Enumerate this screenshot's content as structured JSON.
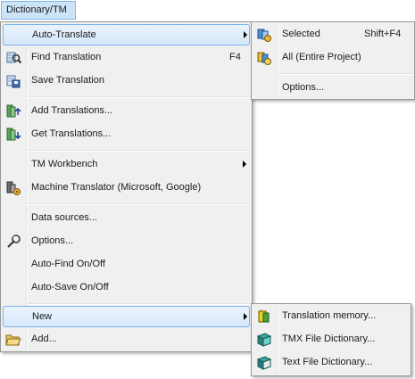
{
  "menubar": {
    "dictionary_tm": "Dictionary/TM"
  },
  "main_menu": {
    "auto_translate": "Auto-Translate",
    "find_translation": "Find Translation",
    "find_translation_shortcut": "F4",
    "save_translation": "Save Translation",
    "add_translations": "Add Translations...",
    "get_translations": "Get Translations...",
    "tm_workbench": "TM Workbench",
    "machine_translator": "Machine Translator (Microsoft, Google)",
    "data_sources": "Data sources...",
    "options": "Options...",
    "auto_find": "Auto-Find On/Off",
    "auto_save": "Auto-Save On/Off",
    "new": "New",
    "add": "Add..."
  },
  "auto_translate_submenu": {
    "selected": "Selected",
    "selected_shortcut": "Shift+F4",
    "all": "All (Entire Project)",
    "options": "Options..."
  },
  "new_submenu": {
    "translation_memory": "Translation memory...",
    "tmx_file_dictionary": "TMX File Dictionary...",
    "text_file_dictionary": "Text File Dictionary..."
  }
}
